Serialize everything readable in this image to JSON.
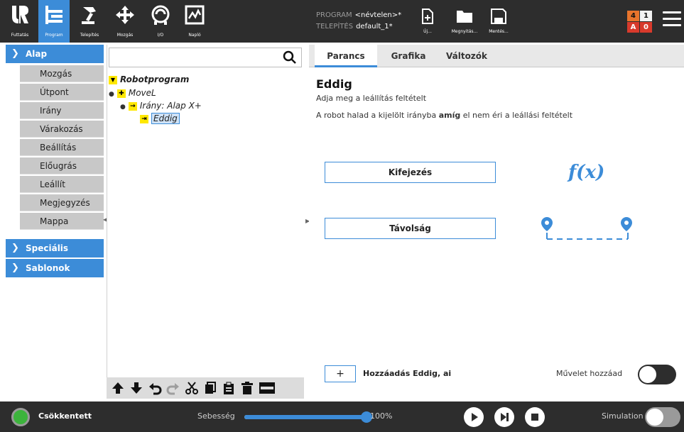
{
  "header": {
    "tabs": [
      {
        "label": "Futtatás",
        "icon": "ur-logo-icon"
      },
      {
        "label": "Program",
        "icon": "program-icon"
      },
      {
        "label": "Telepítés",
        "icon": "robot-arm-icon"
      },
      {
        "label": "Mozgás",
        "icon": "move-arrows-icon"
      },
      {
        "label": "I/O",
        "icon": "io-icon"
      },
      {
        "label": "Napló",
        "icon": "log-icon"
      }
    ],
    "program_label": "PROGRAM",
    "program_value": "<névtelen>*",
    "install_label": "TELEPÍTÉS",
    "install_value": "default_1*",
    "file_buttons": [
      {
        "label": "Új...",
        "icon": "new-file-icon"
      },
      {
        "label": "Megnyitás...",
        "icon": "folder-icon"
      },
      {
        "label": "Mentés...",
        "icon": "save-icon"
      }
    ],
    "counter": {
      "tl": "4",
      "tr": "1",
      "bl": "A",
      "br": "0"
    },
    "accent": "#3c8cd8"
  },
  "sidebar": {
    "categories": {
      "basic": "Alap",
      "advanced": "Speciális",
      "templates": "Sablonok"
    },
    "items": [
      "Mozgás",
      "Útpont",
      "Irány",
      "Várakozás",
      "Beállítás",
      "Előugrás",
      "Leállít",
      "Megjegyzés",
      "Mappa"
    ]
  },
  "tree": {
    "search_placeholder": "",
    "root": "Robotprogram",
    "nodes": [
      "MoveL",
      "Irány: Alap X+",
      "Eddig"
    ]
  },
  "right": {
    "tabs": [
      "Parancs",
      "Grafika",
      "Változók"
    ],
    "title": "Eddig",
    "subtitle": "Adja meg a leállítás feltételt",
    "desc_pre": "A robot halad a kijelölt irányba ",
    "desc_bold": "amíg",
    "desc_post": " el nem éri a leállási feltételt",
    "option1": "Kifejezés",
    "option2": "Távolság",
    "fx": "f(x)",
    "add_symbol": "+",
    "add_label": "Hozzáadás Eddig, ai",
    "operation_label": "Művelet hozzáad"
  },
  "footer": {
    "mode": "Csökkentett",
    "speed_label": "Sebesség",
    "speed_value": "100%",
    "speed_fraction": 1.0,
    "sim_label": "Simulation"
  }
}
